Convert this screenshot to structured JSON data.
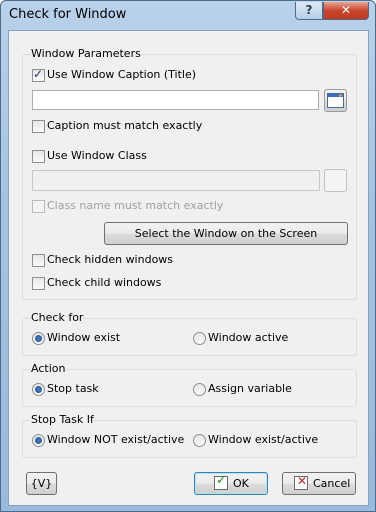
{
  "window": {
    "title": "Check for Window",
    "help": "?",
    "close": "✕"
  },
  "params": {
    "group": "Window Parameters",
    "use_caption": "Use Window Caption (Title)",
    "caption_value": "",
    "caption_exact": "Caption must match exactly",
    "use_class": "Use Window Class",
    "class_value": "",
    "class_exact": "Class name must match exactly",
    "select_button": "Select the Window on the Screen",
    "check_hidden": "Check hidden windows",
    "check_child": "Check child windows"
  },
  "checkfor": {
    "group": "Check for",
    "opt1": "Window exist",
    "opt2": "Window active"
  },
  "action": {
    "group": "Action",
    "opt1": "Stop task",
    "opt2": "Assign variable"
  },
  "stopif": {
    "group": "Stop Task If",
    "opt1": "Window NOT exist/active",
    "opt2": "Window exist/active"
  },
  "footer": {
    "var_button": "{V}",
    "ok": "OK",
    "cancel": "Cancel"
  }
}
